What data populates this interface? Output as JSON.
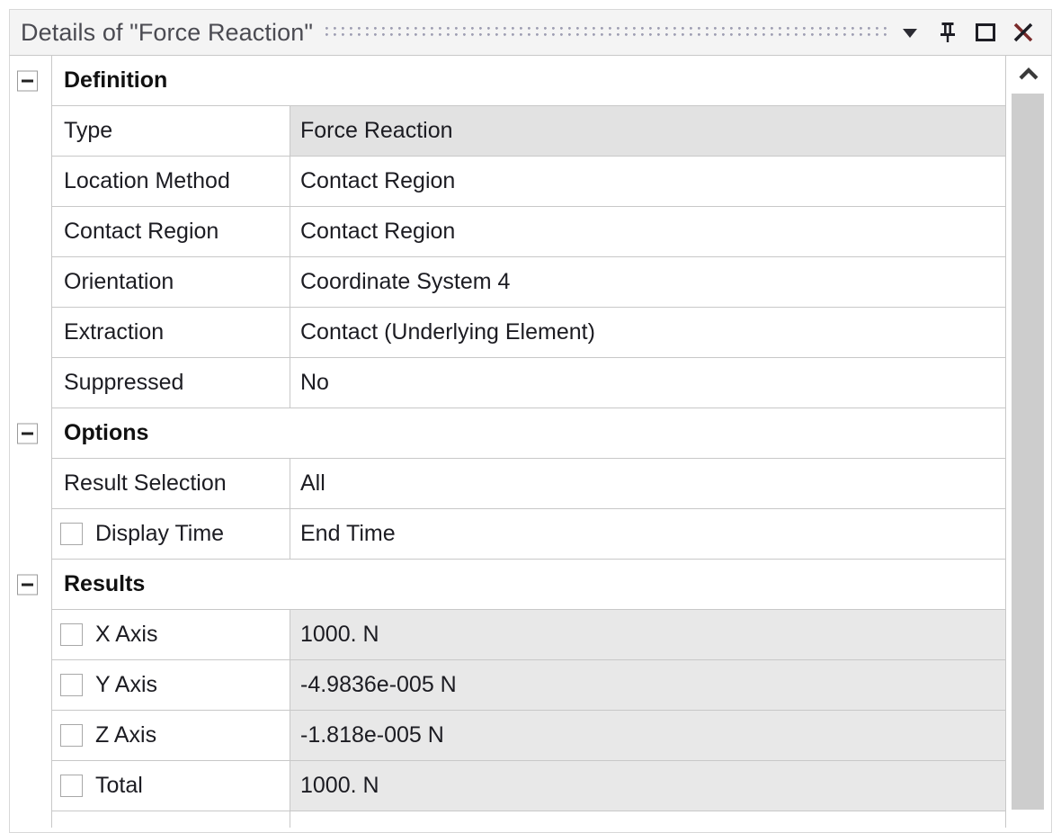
{
  "window": {
    "title": "Details of \"Force Reaction\"",
    "controls": [
      {
        "name": "dropdown-chevron",
        "icon": "chevron-down-icon",
        "label": "▼"
      },
      {
        "name": "auto-hide-pin",
        "icon": "pin-icon",
        "label": "中"
      },
      {
        "name": "maximize",
        "icon": "maximize-icon",
        "label": "□"
      },
      {
        "name": "close",
        "icon": "close-icon",
        "label": "✕"
      }
    ]
  },
  "colors": {
    "titlebar_bg": "#f4f4f4",
    "title_text": "#4b4b52",
    "grid_border": "#c8c8c8",
    "readonly_cell": "#e8e8e8",
    "selected_cell": "#e2e2e2",
    "scrollbar_thumb": "#cdcdcd",
    "dots": "#9b9bb0"
  },
  "sections": [
    {
      "id": "definition",
      "title": "Definition",
      "collapsed": false,
      "toggle_glyph": "−",
      "rows": [
        {
          "name": "Type",
          "value": "Force Reaction",
          "checkbox": false,
          "state": "selected"
        },
        {
          "name": "Location Method",
          "value": "Contact Region",
          "checkbox": false,
          "state": "normal"
        },
        {
          "name": "Contact Region",
          "value": "Contact Region",
          "checkbox": false,
          "state": "normal"
        },
        {
          "name": "Orientation",
          "value": "Coordinate System 4",
          "checkbox": false,
          "state": "normal"
        },
        {
          "name": "Extraction",
          "value": "Contact (Underlying Element)",
          "checkbox": false,
          "state": "normal"
        },
        {
          "name": "Suppressed",
          "value": "No",
          "checkbox": false,
          "state": "normal"
        }
      ]
    },
    {
      "id": "options",
      "title": "Options",
      "collapsed": false,
      "toggle_glyph": "−",
      "rows": [
        {
          "name": "Result Selection",
          "value": "All",
          "checkbox": false,
          "state": "normal"
        },
        {
          "name": "Display Time",
          "value": "End Time",
          "checkbox": true,
          "checked": false,
          "state": "normal"
        }
      ]
    },
    {
      "id": "results",
      "title": "Results",
      "collapsed": false,
      "toggle_glyph": "−",
      "rows": [
        {
          "name": "X Axis",
          "value": "1000. N",
          "checkbox": true,
          "checked": false,
          "state": "readonly"
        },
        {
          "name": "Y Axis",
          "value": "-4.9836e-005 N",
          "checkbox": true,
          "checked": false,
          "state": "readonly"
        },
        {
          "name": "Z Axis",
          "value": "-1.818e-005 N",
          "checkbox": true,
          "checked": false,
          "state": "readonly"
        },
        {
          "name": "Total",
          "value": "1000. N",
          "checkbox": true,
          "checked": false,
          "state": "readonly"
        }
      ]
    }
  ],
  "scrollbar": {
    "up_arrow": "⌃",
    "position": "top"
  }
}
